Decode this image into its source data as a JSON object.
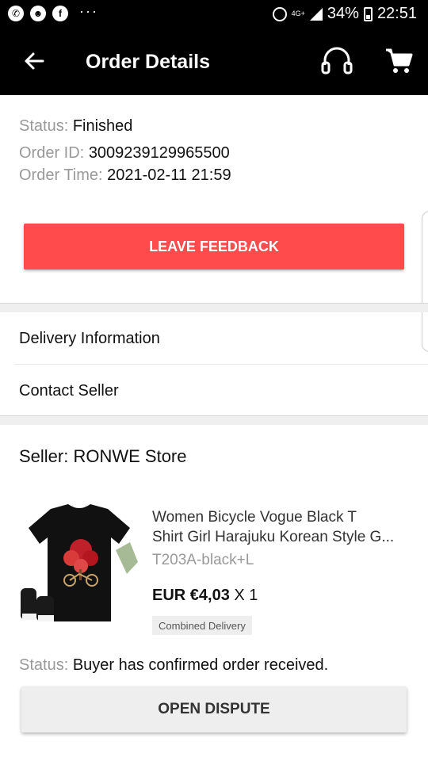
{
  "statusbar": {
    "battery": "34%",
    "time": "22:51",
    "network": "4G+"
  },
  "appbar": {
    "title": "Order Details"
  },
  "order": {
    "status_label": "Status:",
    "status_value": "Finished",
    "id_label": "Order ID:",
    "id_value": "3009239129965500",
    "time_label": "Order Time:",
    "time_value": "2021-02-11 21:59",
    "feedback_label": "LEAVE FEEDBACK"
  },
  "links": {
    "delivery": "Delivery Information",
    "contact": "Contact Seller"
  },
  "seller": {
    "label": "Seller: RONWE Store"
  },
  "product": {
    "title_line1": "Women Bicycle Vogue Black T",
    "title_line2": "Shirt Girl Harajuku Korean Style G...",
    "sku": "T203A-black+L",
    "price": "EUR €4,03",
    "qty": "X 1",
    "tag": "Combined Delivery"
  },
  "item_status": {
    "label": "Status:",
    "value": "Buyer has confirmed order received."
  },
  "dispute": {
    "label": "OPEN DISPUTE"
  },
  "colors": {
    "accent": "#ff4b4b",
    "appbar": "#000000"
  }
}
